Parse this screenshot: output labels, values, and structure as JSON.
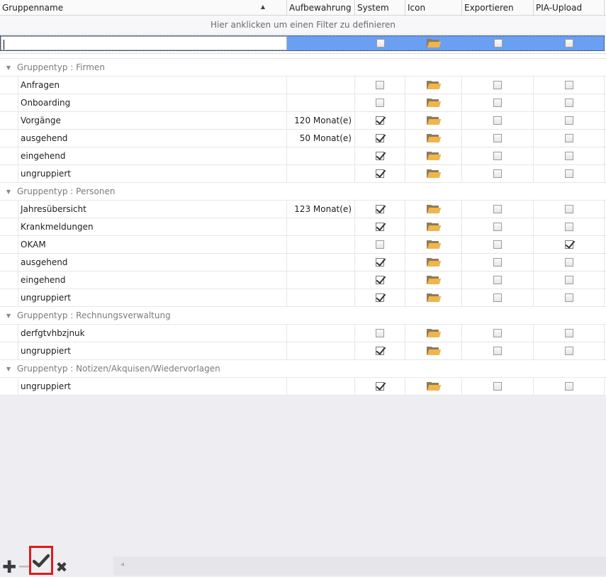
{
  "columns": {
    "name": "Gruppenname",
    "aufbewahrung": "Aufbewahrung",
    "system": "System",
    "icon": "Icon",
    "exportieren": "Exportieren",
    "pia": "PIA-Upload"
  },
  "sort_indicator": "▲",
  "filter_hint": "Hier anklicken um einen Filter zu definieren",
  "groups": [
    {
      "label": "Gruppentyp : Firmen",
      "rows": [
        {
          "name": "Anfragen",
          "aufbewahrung": "",
          "system": false,
          "export": false,
          "pia": false
        },
        {
          "name": "Onboarding",
          "aufbewahrung": "",
          "system": false,
          "export": false,
          "pia": false
        },
        {
          "name": "Vorgänge",
          "aufbewahrung": "120 Monat(e)",
          "system": true,
          "export": false,
          "pia": false
        },
        {
          "name": "ausgehend",
          "aufbewahrung": "50 Monat(e)",
          "system": true,
          "export": false,
          "pia": false
        },
        {
          "name": "eingehend",
          "aufbewahrung": "",
          "system": true,
          "export": false,
          "pia": false
        },
        {
          "name": "ungruppiert",
          "aufbewahrung": "",
          "system": true,
          "export": false,
          "pia": false
        }
      ]
    },
    {
      "label": "Gruppentyp : Personen",
      "rows": [
        {
          "name": "Jahresübersicht",
          "aufbewahrung": "123 Monat(e)",
          "system": true,
          "export": false,
          "pia": false
        },
        {
          "name": "Krankmeldungen",
          "aufbewahrung": "",
          "system": true,
          "export": false,
          "pia": false
        },
        {
          "name": "OKAM",
          "aufbewahrung": "",
          "system": false,
          "export": false,
          "pia": true
        },
        {
          "name": "ausgehend",
          "aufbewahrung": "",
          "system": true,
          "export": false,
          "pia": false
        },
        {
          "name": "eingehend",
          "aufbewahrung": "",
          "system": true,
          "export": false,
          "pia": false
        },
        {
          "name": "ungruppiert",
          "aufbewahrung": "",
          "system": true,
          "export": false,
          "pia": false
        }
      ]
    },
    {
      "label": "Gruppentyp : Rechnungsverwaltung",
      "rows": [
        {
          "name": "derfgtvhbzjnuk",
          "aufbewahrung": "",
          "system": false,
          "export": false,
          "pia": false
        },
        {
          "name": "ungruppiert",
          "aufbewahrung": "",
          "system": true,
          "export": false,
          "pia": false
        }
      ]
    },
    {
      "label": "Gruppentyp : Notizen/Akquisen/Wiedervorlagen",
      "rows": [
        {
          "name": "ungruppiert",
          "aufbewahrung": "",
          "system": true,
          "export": false,
          "pia": false
        }
      ]
    }
  ],
  "toolbar": {
    "add_icon": "plus-icon",
    "remove_icon": "minus-icon",
    "accept_icon": "checkmark-icon",
    "cancel_icon": "x-icon",
    "highlight_color": "#e01a1a"
  },
  "colors": {
    "selection": "#6a9ff2",
    "folder": "#f0b54b"
  }
}
